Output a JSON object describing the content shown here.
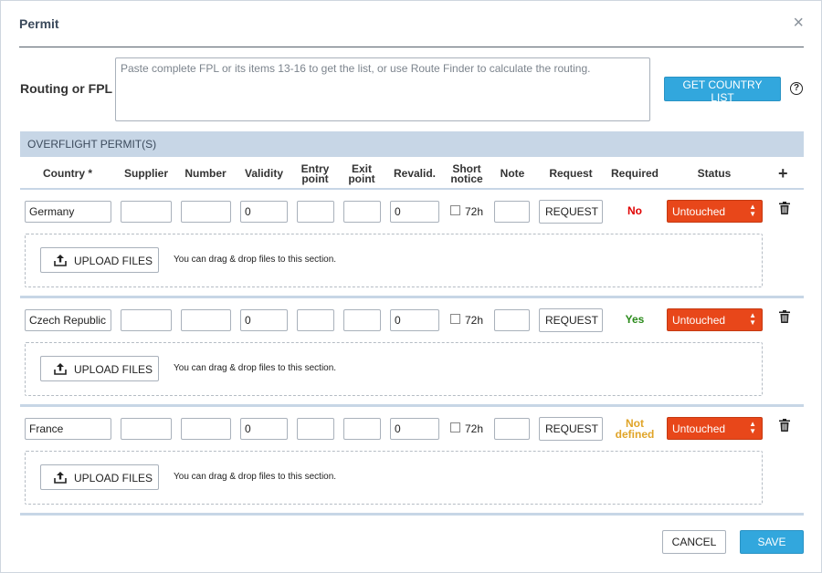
{
  "dialog": {
    "title": "Permit",
    "close_icon": "×"
  },
  "routing": {
    "label": "Routing or FPL",
    "placeholder": "Paste complete FPL or its items 13-16 to get the list, or use Route Finder to calculate the routing.",
    "value": "",
    "get_country_list_label": "GET COUNTRY LIST",
    "help_icon": "?"
  },
  "section": {
    "title": "OVERFLIGHT PERMIT(S)"
  },
  "columns": {
    "country": "Country *",
    "supplier": "Supplier",
    "number": "Number",
    "validity": "Validity",
    "entry_1": "Entry",
    "entry_2": "point",
    "exit_1": "Exit",
    "exit_2": "point",
    "revalid": "Revalid.",
    "short_1": "Short",
    "short_2": "notice",
    "note": "Note",
    "request": "Request",
    "required": "Required",
    "status": "Status",
    "add_icon": "+"
  },
  "rows": [
    {
      "country": "Germany",
      "supplier": "",
      "number": "",
      "validity": "0",
      "entry": "",
      "exit": "",
      "revalid": "0",
      "short_notice_label": "72h",
      "short_notice_checked": false,
      "note": "",
      "request_label": "REQUEST",
      "required_1": "No",
      "required_2": "",
      "required_color": "#e00000",
      "status": "Untouched",
      "status_color": "#e8471a",
      "upload_label": "UPLOAD FILES",
      "dropzone_text": "You can drag & drop files to this section."
    },
    {
      "country": "Czech Republic",
      "supplier": "",
      "number": "",
      "validity": "0",
      "entry": "",
      "exit": "",
      "revalid": "0",
      "short_notice_label": "72h",
      "short_notice_checked": false,
      "note": "",
      "request_label": "REQUEST",
      "required_1": "Yes",
      "required_2": "",
      "required_color": "#2a8a1a",
      "status": "Untouched",
      "status_color": "#e8471a",
      "upload_label": "UPLOAD FILES",
      "dropzone_text": "You can drag & drop files to this section."
    },
    {
      "country": "France",
      "supplier": "",
      "number": "",
      "validity": "0",
      "entry": "",
      "exit": "",
      "revalid": "0",
      "short_notice_label": "72h",
      "short_notice_checked": false,
      "note": "",
      "request_label": "REQUEST",
      "required_1": "Not",
      "required_2": "defined",
      "required_color": "#e0a428",
      "status": "Untouched",
      "status_color": "#e8471a",
      "upload_label": "UPLOAD FILES",
      "dropzone_text": "You can drag & drop files to this section."
    }
  ],
  "footer": {
    "cancel_label": "CANCEL",
    "save_label": "SAVE"
  },
  "colors": {
    "accent": "#32a7dd",
    "section_bar": "#c7d6e6",
    "status_untouched": "#e8471a"
  }
}
